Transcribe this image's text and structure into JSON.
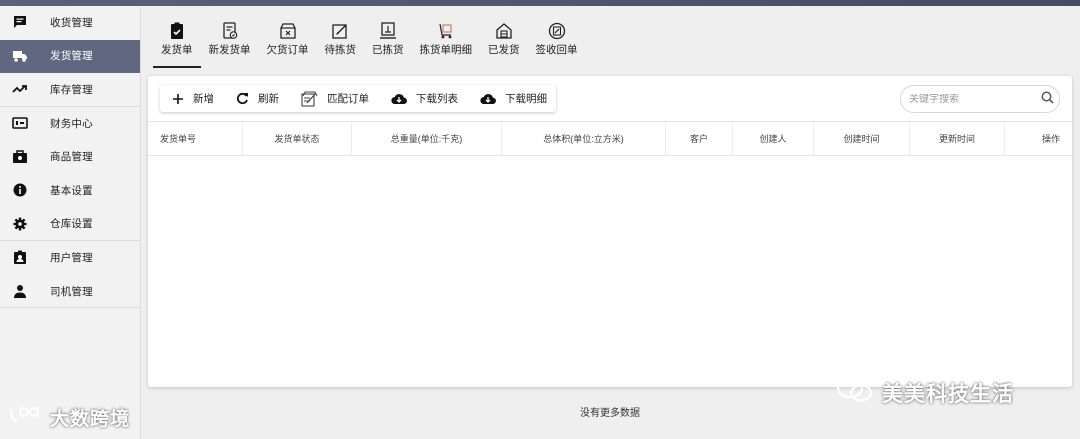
{
  "sidebar": {
    "items": [
      {
        "label": "收货管理",
        "icon": "message-icon"
      },
      {
        "label": "发货管理",
        "icon": "truck-icon",
        "active": true
      },
      {
        "label": "库存管理",
        "icon": "trend-icon"
      },
      {
        "label": "财务中心",
        "icon": "finance-icon"
      },
      {
        "label": "商品管理",
        "icon": "goods-icon"
      },
      {
        "label": "基本设置",
        "icon": "info-icon"
      },
      {
        "label": "仓库设置",
        "icon": "gear-icon"
      },
      {
        "label": "用户管理",
        "icon": "user-badge-icon"
      },
      {
        "label": "司机管理",
        "icon": "driver-icon"
      }
    ]
  },
  "tabs": [
    {
      "label": "发货单",
      "active": true
    },
    {
      "label": "新发货单"
    },
    {
      "label": "欠货订单"
    },
    {
      "label": "待拣货"
    },
    {
      "label": "已拣货"
    },
    {
      "label": "拣货单明细"
    },
    {
      "label": "已发货"
    },
    {
      "label": "签收回单"
    }
  ],
  "toolbar": {
    "add_label": "新增",
    "refresh_label": "刷新",
    "match_label": "匹配订单",
    "download_list_label": "下载列表",
    "download_detail_label": "下载明细"
  },
  "search": {
    "placeholder": "关键字搜索"
  },
  "table": {
    "columns": [
      "发货单号",
      "发货单状态",
      "总重量(单位:千克)",
      "总体积(单位:立方米)",
      "客户",
      "创建人",
      "创建时间",
      "更新时间",
      "操作"
    ],
    "rows": []
  },
  "footer": {
    "empty_text": "没有更多数据"
  },
  "watermarks": {
    "left": "大数跨境",
    "right": "美美科技生活"
  },
  "colors": {
    "sidebar_active": "#5f6781",
    "topbar": "#4d5470"
  }
}
